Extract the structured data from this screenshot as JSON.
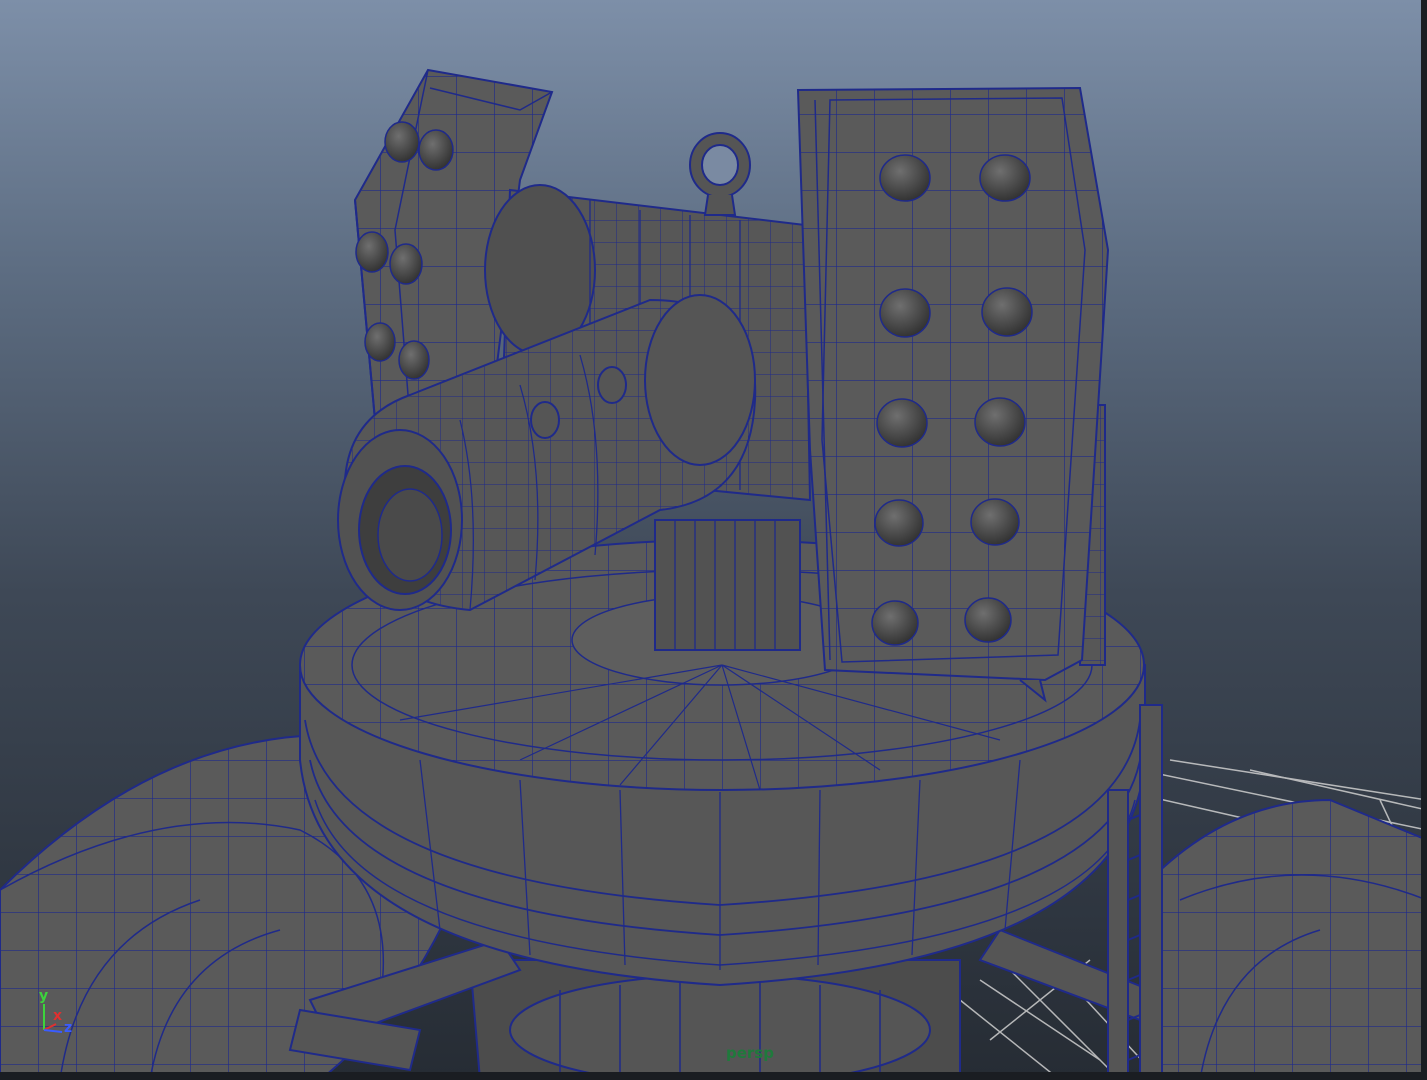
{
  "viewport": {
    "camera_label": "persp",
    "wire_color": "#1f2a8a",
    "mesh_color": "#5c5c5c"
  },
  "axis": {
    "y_label": "y",
    "x_label": "x",
    "z_label": "z",
    "y_color": "#3cd43c",
    "x_color": "#e03030",
    "z_color": "#3a5cff"
  }
}
